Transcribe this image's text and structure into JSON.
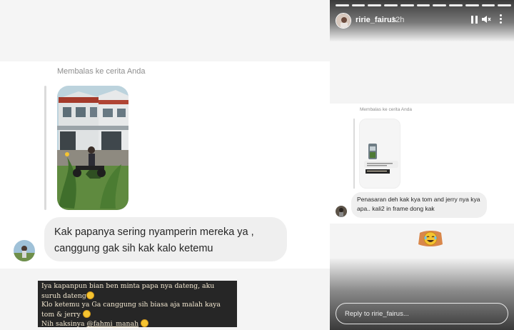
{
  "left": {
    "reply_label": "Membalas ke cerita Anda",
    "message": "Kak papanya sering nyamperin mereka ya , canggung gak sih kak kalo ketemu",
    "caption": {
      "line1": "Iya kapanpun bian ben minta papa nya dateng, aku suruh dateng",
      "line2": "Klo ketemu ya Ga canggung sih biasa aja malah kaya tom & jerry",
      "line3_prefix": "Nih saksinya ",
      "mention": "@fahmi_manah"
    }
  },
  "right": {
    "username": "ririe_fairus",
    "time": "12h",
    "reply_label": "Membalas ke cerita Anda",
    "message": "Penasaran deh kak kya tom and jerry nya kya apa.. kali2 in frame dong kak",
    "reply_placeholder": "Reply to ririe_fairus..."
  },
  "icons": {
    "pause": "pause-icon",
    "mute": "mute-icon",
    "more": "more-icon",
    "sticker": "laughing-emoji-sticker"
  },
  "colors": {
    "bubble": "#efefef",
    "caption_bg": "#262626",
    "caption_text": "#f2e7d0",
    "emoji": "#f5c431"
  }
}
